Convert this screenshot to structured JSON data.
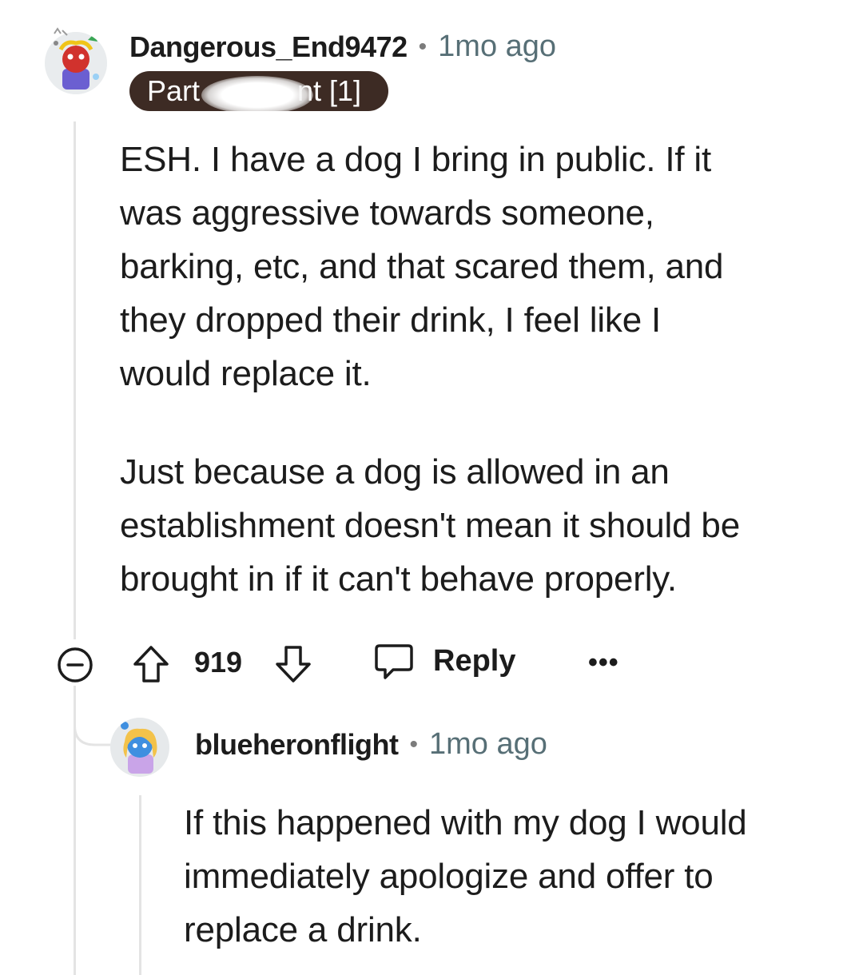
{
  "comment": {
    "username": "Dangerous_End9472",
    "separator": "•",
    "time": "1mo ago",
    "flair_left": "Part",
    "flair_right": "nt [1]",
    "paragraph1": [
      "ESH. I have a dog I bring in public. If it",
      "was aggressive towards someone,",
      "barking, etc, and that scared them, and",
      "they dropped their drink, I feel like I",
      "would replace it."
    ],
    "paragraph2": [
      "Just because a dog is allowed in an",
      "establishment doesn't mean it should be",
      "brought in if it can't behave properly."
    ],
    "votes": "919",
    "reply_label": "Reply",
    "more_label": "•••",
    "icons": [
      "collapse-icon",
      "upvote-icon",
      "downvote-icon",
      "reply-icon",
      "more-icon"
    ]
  },
  "reply": {
    "username": "blueheronflight",
    "separator": "•",
    "time": "1mo ago",
    "lines": [
      "If this happened with my dog I would",
      "immediately apologize and offer to",
      "replace a drink."
    ]
  },
  "colors": {
    "flair_bg": "#3d2b24",
    "thread_line": "#e4e4e4",
    "meta_text": "#576f76"
  }
}
